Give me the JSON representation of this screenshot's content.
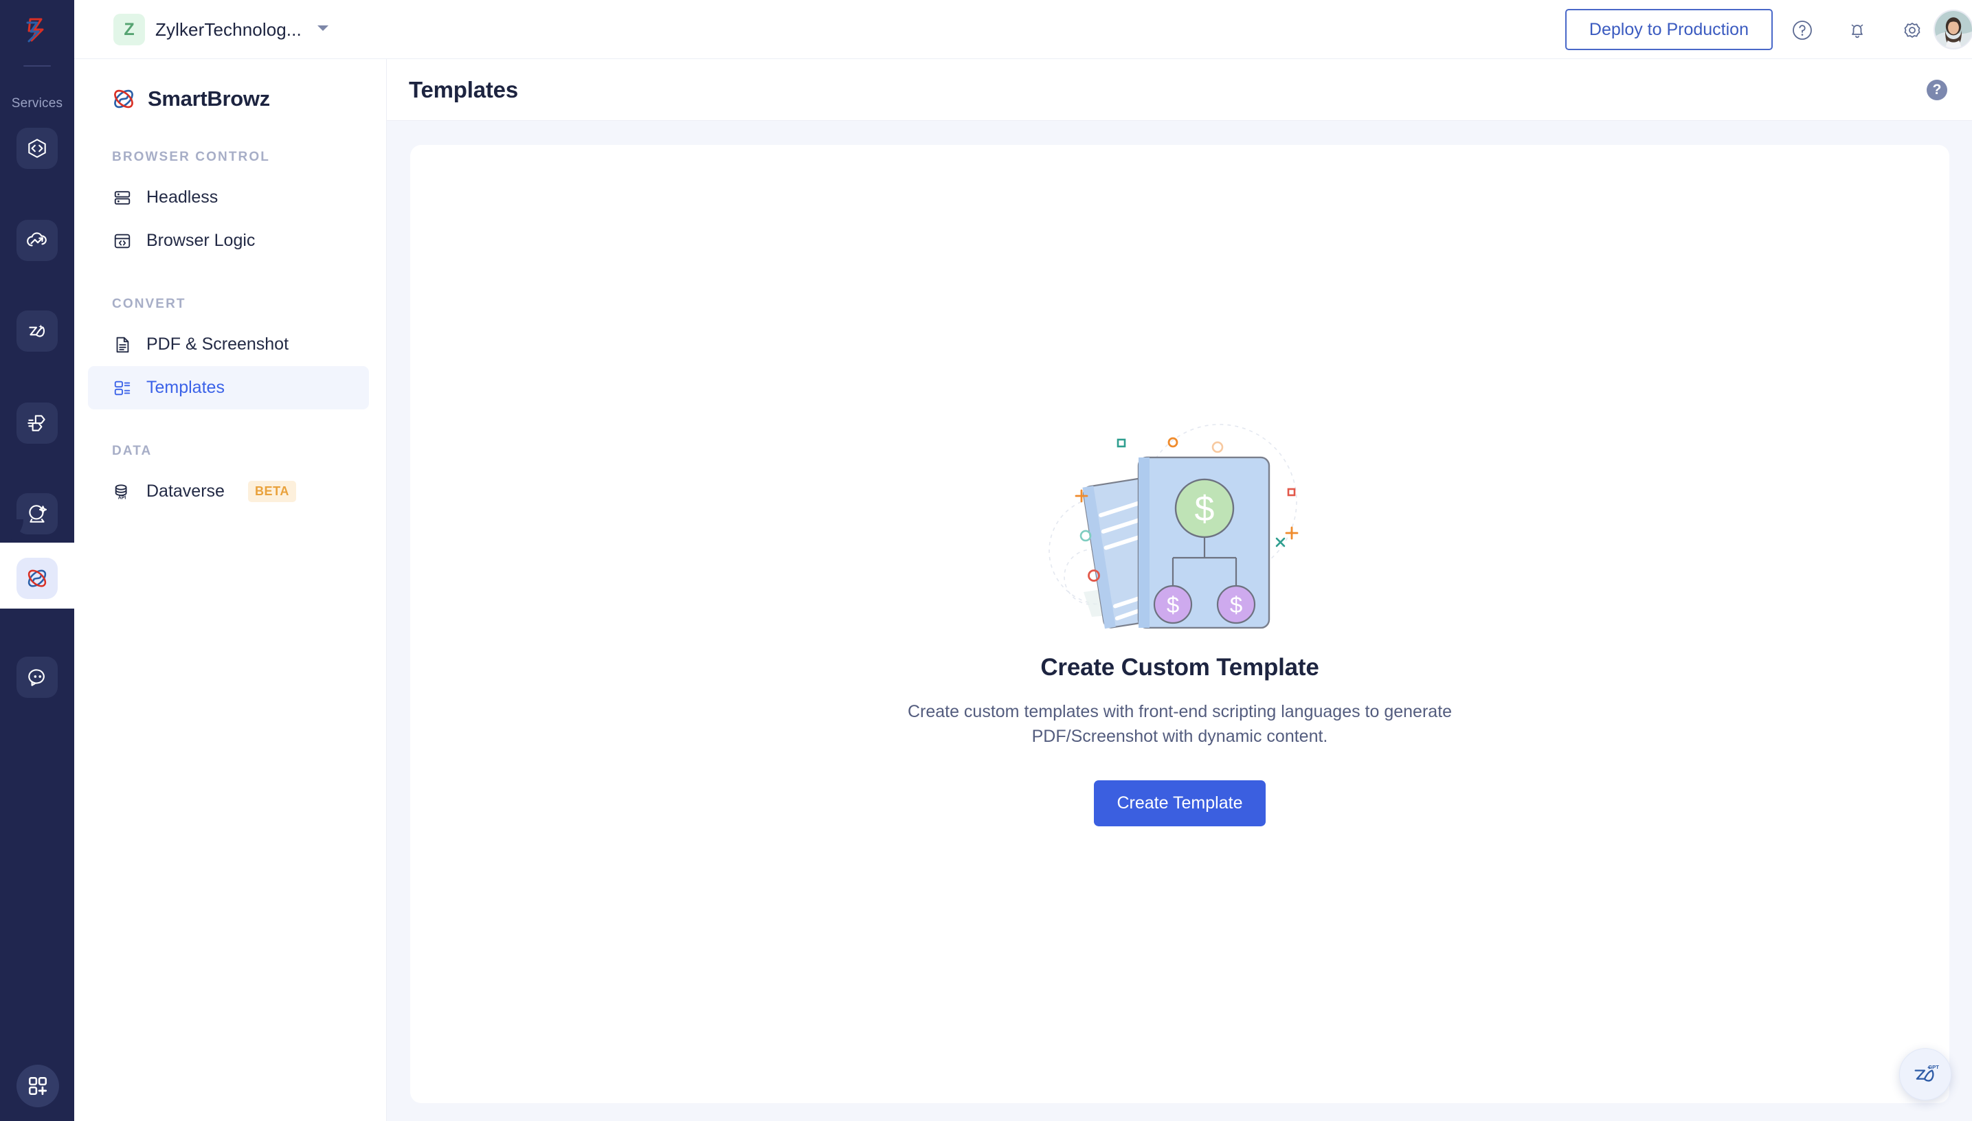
{
  "app_rail": {
    "services_label": "Services",
    "logo_icon": "zoho-logo-icon",
    "items": [
      {
        "name": "code-service",
        "icon": "code-brackets-icon"
      },
      {
        "name": "cloud-analytics-service",
        "icon": "cloud-arrow-icon"
      },
      {
        "name": "zia-service",
        "icon": "zia-icon"
      },
      {
        "name": "flow-service",
        "icon": "flow-arrows-icon"
      },
      {
        "name": "vision-service",
        "icon": "crystal-ball-icon"
      },
      {
        "name": "smartbrowz-service",
        "icon": "smartbrowz-icon",
        "active": true
      },
      {
        "name": "chat-service",
        "icon": "chat-bubble-icon"
      }
    ],
    "bottom_item": {
      "name": "all-apps",
      "icon": "grid-plus-icon"
    }
  },
  "topbar": {
    "org_initial": "Z",
    "org_name": "ZylkerTechnolog...",
    "deploy_label": "Deploy to Production",
    "help_icon": "question-circle-icon",
    "bell_icon": "notification-bell-icon",
    "gear_icon": "settings-gear-icon",
    "avatar_icon": "user-avatar"
  },
  "sidebar": {
    "product_name": "SmartBrowz",
    "product_icon": "smartbrowz-icon",
    "sections": [
      {
        "title": "BROWSER CONTROL",
        "items": [
          {
            "label": "Headless",
            "icon": "server-stack-icon",
            "active": false
          },
          {
            "label": "Browser Logic",
            "icon": "browser-code-icon",
            "active": false
          }
        ]
      },
      {
        "title": "CONVERT",
        "items": [
          {
            "label": "PDF & Screenshot",
            "icon": "document-icon",
            "active": false
          },
          {
            "label": "Templates",
            "icon": "template-layout-icon",
            "active": true
          }
        ]
      },
      {
        "title": "DATA",
        "items": [
          {
            "label": "Dataverse",
            "icon": "database-api-icon",
            "active": false,
            "badge": "BETA"
          }
        ]
      }
    ]
  },
  "main": {
    "page_title": "Templates",
    "help_icon": "question-mark-icon",
    "help_glyph": "?",
    "empty_state": {
      "illustration": "documents-money-flow-illustration",
      "title": "Create Custom Template",
      "description": "Create custom templates with front-end scripting languages to generate PDF/Screenshot with dynamic content.",
      "button_label": "Create Template"
    }
  },
  "floating": {
    "zia_label": "Zia GPT",
    "zia_icon": "zia-gpt-icon"
  },
  "colors": {
    "rail_bg": "#20264f",
    "accent_blue": "#3b5fe0",
    "active_nav_bg": "#f2f5fd",
    "active_nav_text": "#3b62e8",
    "beta_badge_bg": "#fdf0dc",
    "beta_badge_text": "#e9a13b",
    "main_bg": "#f4f6fc",
    "title_text": "#1d2440",
    "muted_text": "#535c7e",
    "section_title": "#a7aec7"
  }
}
